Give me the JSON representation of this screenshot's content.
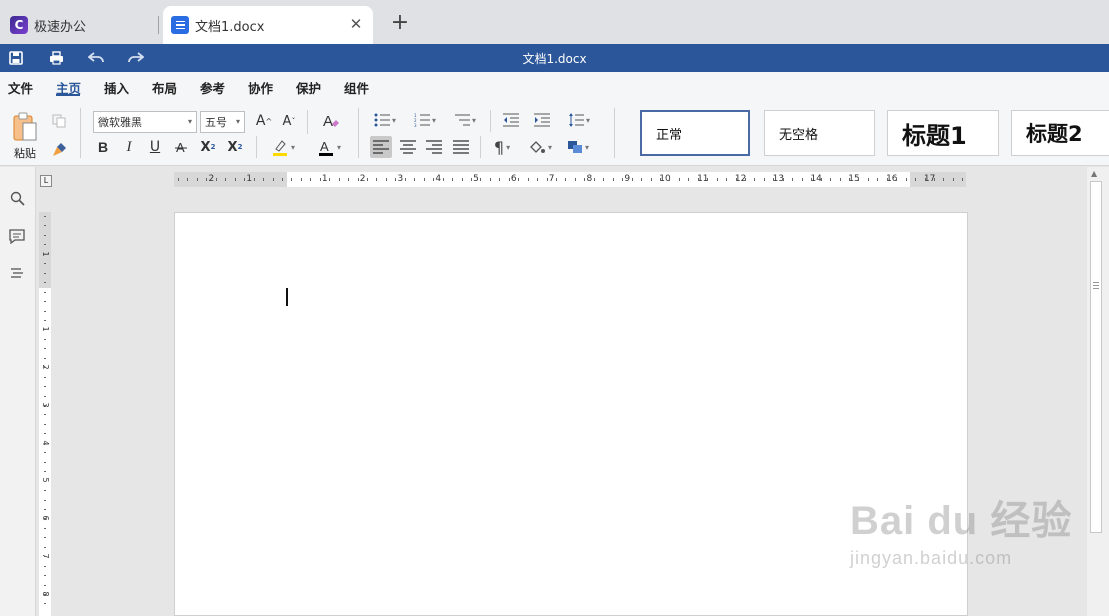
{
  "tabs": {
    "home_label": "极速办公",
    "doc_label": "文档1.docx",
    "close_glyph": "✕",
    "new_tab_glyph": "+"
  },
  "titlebar": {
    "title": "文档1.docx",
    "quick_access": [
      "save-icon",
      "print-icon",
      "undo-icon",
      "redo-icon"
    ],
    "bg_color": "#2b579a"
  },
  "menu": {
    "items": [
      "文件",
      "主页",
      "插入",
      "布局",
      "参考",
      "协作",
      "保护",
      "组件"
    ],
    "active": "主页"
  },
  "ribbon": {
    "paste_label": "粘贴",
    "font_name": "微软雅黑",
    "font_size": "五号",
    "bold_label": "B",
    "italic_label": "I",
    "underline_label": "U",
    "styles": [
      "正常",
      "无空格",
      "标题1",
      "标题2"
    ]
  },
  "ruler": {
    "numbers": [
      "2",
      "1",
      "1",
      "2",
      "3",
      "4",
      "5",
      "6",
      "7",
      "8",
      "9",
      "10",
      "11",
      "12",
      "13",
      "14",
      "15",
      "16",
      "17"
    ],
    "vertical_numbers": [
      "1",
      "1",
      "2",
      "3",
      "4",
      "5",
      "6",
      "7",
      "8"
    ],
    "corner_label": "L"
  },
  "sidebar": {
    "icons": [
      "search-icon",
      "comment-icon",
      "navigation-icon"
    ]
  },
  "watermark": {
    "brand": "Bai du 经验",
    "url": "jingyan.baidu.com"
  },
  "colors": {
    "accent": "#2b579a",
    "highlight": "#ffd800",
    "font_color": "#000000"
  }
}
